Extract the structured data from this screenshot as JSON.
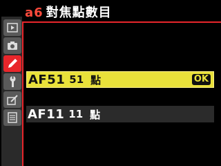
{
  "header": {
    "code": "a6",
    "title": "對焦點數目"
  },
  "sidebar": {
    "items": [
      {
        "icon": "playback-icon",
        "active": false
      },
      {
        "icon": "camera-icon",
        "active": false
      },
      {
        "icon": "pencil-icon",
        "active": true
      },
      {
        "icon": "wrench-icon",
        "active": false
      },
      {
        "icon": "retouch-icon",
        "active": false
      },
      {
        "icon": "my-menu-icon",
        "active": false
      }
    ]
  },
  "options": [
    {
      "code": "AF51",
      "count": "51",
      "unit": "點",
      "selected": true
    },
    {
      "code": "AF11",
      "count": "11",
      "unit": "點",
      "selected": false
    }
  ],
  "ok_label": "OK",
  "colors": {
    "accent": "#e8262b",
    "highlight": "#e9e13a",
    "background": "#000000"
  }
}
